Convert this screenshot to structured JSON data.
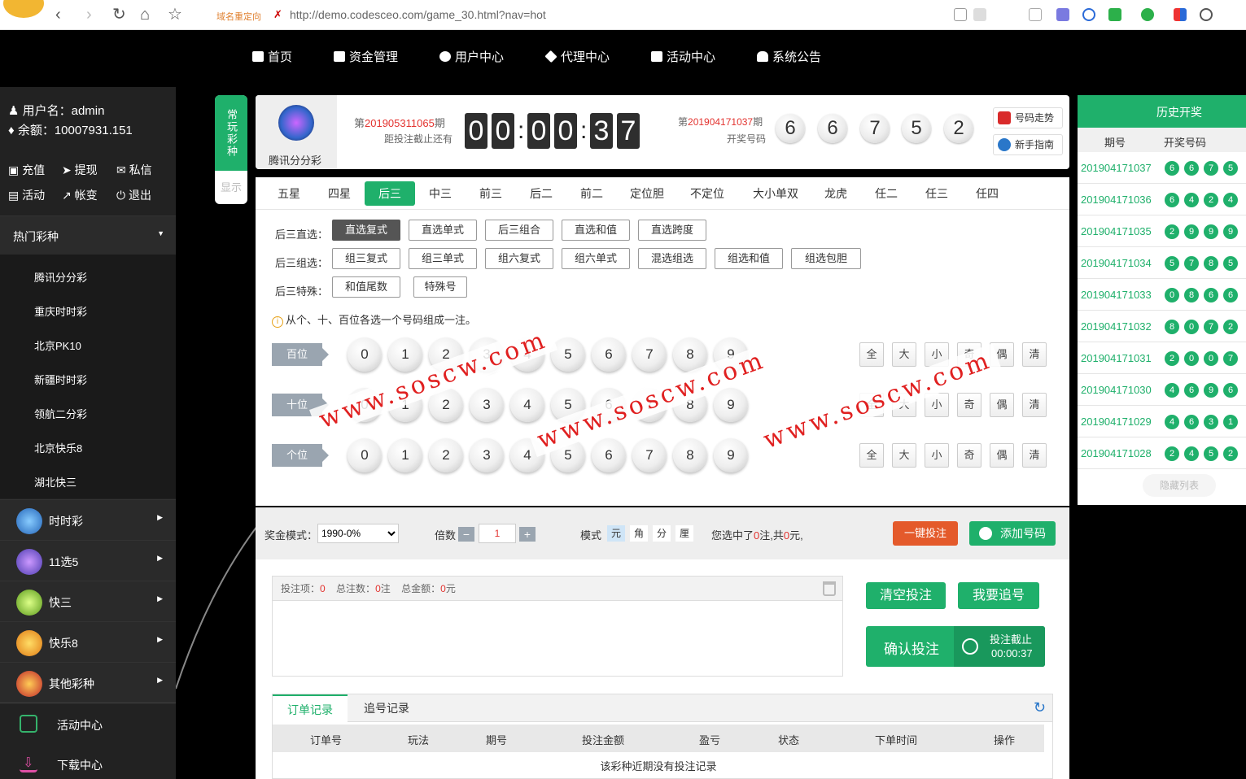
{
  "browser": {
    "redirect_label": "域名重定向",
    "url": "http://demo.codesceo.com/game_30.html?nav=hot"
  },
  "topnav": [
    {
      "label": "首页",
      "icon": "home-icon"
    },
    {
      "label": "资金管理",
      "icon": "wallet-icon"
    },
    {
      "label": "用户中心",
      "icon": "user-icon"
    },
    {
      "label": "代理中心",
      "icon": "diamond-icon"
    },
    {
      "label": "活动中心",
      "icon": "gift-icon"
    },
    {
      "label": "系统公告",
      "icon": "bell-icon"
    }
  ],
  "sidebar": {
    "username_label": "用户名：admin",
    "balance_label": "余额：10007931.151",
    "links": [
      "充值",
      "提现",
      "私信",
      "活动",
      "帐变",
      "退出"
    ],
    "hot_title": "热门彩种",
    "hot_items": [
      "腾讯分分彩",
      "重庆时时彩",
      "北京PK10",
      "新疆时时彩",
      "领航二分彩",
      "北京快乐8",
      "湖北快三"
    ],
    "categories": [
      "时时彩",
      "11选5",
      "快三",
      "快乐8",
      "其他彩种"
    ],
    "bottom": [
      "活动中心",
      "下载中心"
    ]
  },
  "sidetab": {
    "active": "常玩彩种",
    "other": "显示"
  },
  "header": {
    "game_name": "腾讯分分彩",
    "current_prefix": "第",
    "current_issue": "201905311065",
    "current_suffix": "期",
    "countdown_label": "距投注截止还有",
    "countdown": [
      "0",
      "0",
      "0",
      "0",
      "3",
      "7"
    ],
    "last_prefix": "第",
    "last_issue": "201904171037",
    "last_suffix": "期",
    "last_label": "开奖号码",
    "last_numbers": [
      "6",
      "6",
      "7",
      "5",
      "2"
    ],
    "btn_trend": "号码走势",
    "btn_guide": "新手指南"
  },
  "play": {
    "tabs": [
      "五星",
      "四星",
      "后三",
      "中三",
      "前三",
      "后二",
      "前二",
      "定位胆",
      "不定位",
      "大小单双",
      "龙虎",
      "任二",
      "任三",
      "任四"
    ],
    "active_tab": "后三",
    "rows": [
      {
        "label": "后三直选：",
        "options": [
          "直选复式",
          "直选单式",
          "后三组合",
          "直选和值",
          "直选跨度"
        ]
      },
      {
        "label": "后三组选：",
        "options": [
          "组三复式",
          "组三单式",
          "组六复式",
          "组六单式",
          "混选组选",
          "组选和值",
          "组选包胆"
        ]
      },
      {
        "label": "后三特殊：",
        "options": [
          "和值尾数",
          "特殊号"
        ]
      }
    ],
    "active_option": "直选复式",
    "hint": "从个、十、百位各选一个号码组成一注。",
    "positions": [
      "百位",
      "十位",
      "个位"
    ],
    "digits": [
      "0",
      "1",
      "2",
      "3",
      "4",
      "5",
      "6",
      "7",
      "8",
      "9"
    ],
    "quick": [
      "全",
      "大",
      "小",
      "奇",
      "偶",
      "清"
    ],
    "watermark": "www.soscw.com"
  },
  "betbar": {
    "prize_label": "奖金模式：",
    "prize_value": "1990-0%",
    "multiple_label": "倍数",
    "multiple_value": "1",
    "mode_label": "模式",
    "modes": [
      "元",
      "角",
      "分",
      "厘"
    ],
    "summary_prefix": "您选中了",
    "summary_count": "0",
    "summary_mid": "注,共",
    "summary_amount": "0",
    "summary_suffix": "元,",
    "btn_quick": "一键投注",
    "btn_add": "添加号码"
  },
  "betlist": {
    "items_label": "投注项：",
    "items_value": "0",
    "notes_label": "总注数：",
    "notes_value": "0",
    "notes_unit": "注",
    "amount_label": "总金额：",
    "amount_value": "0",
    "amount_unit": "元",
    "btn_clear": "清空投注",
    "btn_chase": "我要追号",
    "btn_confirm": "确认投注",
    "deadline_label": "投注截止",
    "deadline_time": "00:00:37"
  },
  "orders": {
    "tabs": [
      "订单记录",
      "追号记录"
    ],
    "columns": [
      "订单号",
      "玩法",
      "期号",
      "投注金额",
      "盈亏",
      "状态",
      "下单时间",
      "操作"
    ],
    "empty": "该彩种近期没有投注记录"
  },
  "history": {
    "title": "历史开奖",
    "col_issue": "期号",
    "col_numbers": "开奖号码",
    "rows": [
      {
        "issue": "201904171037",
        "nums": [
          "6",
          "6",
          "7",
          "5"
        ]
      },
      {
        "issue": "201904171036",
        "nums": [
          "6",
          "4",
          "2",
          "4"
        ]
      },
      {
        "issue": "201904171035",
        "nums": [
          "2",
          "9",
          "9",
          "9"
        ]
      },
      {
        "issue": "201904171034",
        "nums": [
          "5",
          "7",
          "8",
          "5"
        ]
      },
      {
        "issue": "201904171033",
        "nums": [
          "0",
          "8",
          "6",
          "6"
        ]
      },
      {
        "issue": "201904171032",
        "nums": [
          "8",
          "0",
          "7",
          "2"
        ]
      },
      {
        "issue": "201904171031",
        "nums": [
          "2",
          "0",
          "0",
          "7"
        ]
      },
      {
        "issue": "201904171030",
        "nums": [
          "4",
          "6",
          "9",
          "6"
        ]
      },
      {
        "issue": "201904171029",
        "nums": [
          "4",
          "6",
          "3",
          "1"
        ]
      },
      {
        "issue": "201904171028",
        "nums": [
          "2",
          "4",
          "5",
          "2"
        ]
      }
    ],
    "hide_label": "隐藏列表"
  },
  "colors": {
    "accent": "#1fb06b",
    "danger": "#e3332f",
    "orange": "#e45a2b"
  }
}
